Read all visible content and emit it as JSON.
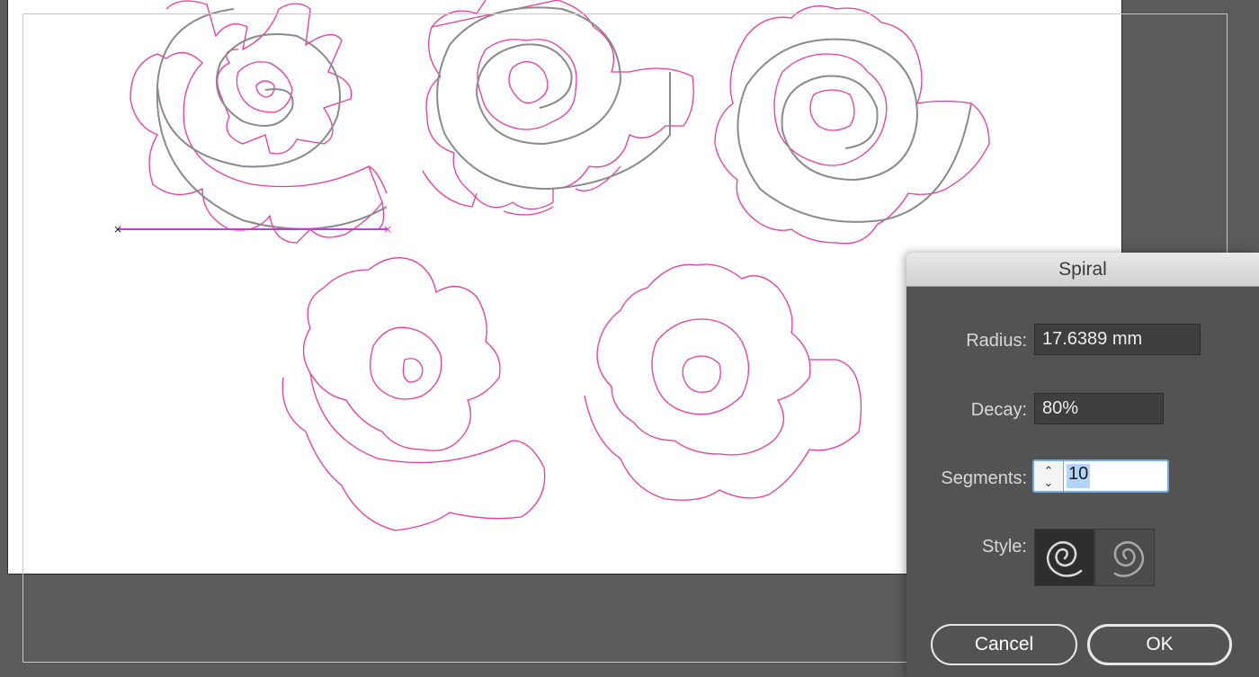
{
  "dialog": {
    "title": "Spiral",
    "radius": {
      "label": "Radius:",
      "value": "17.6389 mm"
    },
    "decay": {
      "label": "Decay:",
      "value": "80%"
    },
    "segments": {
      "label": "Segments:",
      "value": "10"
    },
    "style": {
      "label": "Style:",
      "options": [
        "clockwise-spiral-icon",
        "counterclockwise-spiral-icon"
      ],
      "selected": "clockwise-spiral-icon"
    },
    "buttons": {
      "cancel": "Cancel",
      "ok": "OK"
    }
  },
  "colors": {
    "pasteboard": "#5b5b5b",
    "artboard": "#ffffff",
    "flower_outline": "#e8399d",
    "spiral_path": "#8a8a8a",
    "drag_line": "#c93ad6"
  }
}
